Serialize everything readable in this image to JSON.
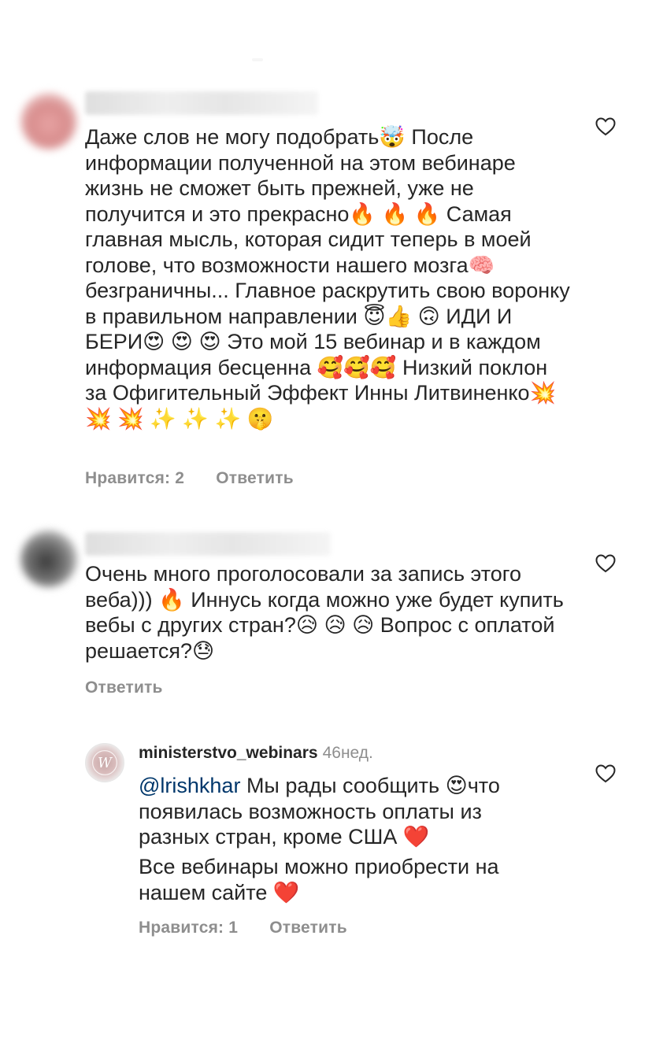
{
  "comments": [
    {
      "text": "Даже слов не могу подобрать🤯 После информации полученной на этом вебинаре жизнь не сможет быть прежней, уже не получится и это прекрасно🔥 🔥 🔥 Самая главная мысль, которая сидит теперь в моей голове, что возможности нашего мозга🧠 безграничны... Главное раскрутить свою воронку в правильном направлении 😇👍 🙃 ИДИ И БЕРИ😍 😍 😍 Это мой 15 вебинар и в каждом информация бесценна 🥰🥰🥰 Низкий поклон за Офигительный Эффект Инны Литвиненко💥 💥 💥 ✨ ✨ ✨ 🤫",
      "likes_label": "Нравится: 2",
      "reply_label": "Ответить"
    },
    {
      "text": "Очень много проголосовали за запись этого веба))) 🔥 Иннусь когда можно уже будет купить вебы с других стран?😥 😥 😥 Вопрос с оплатой решается?😓",
      "reply_label": "Ответить"
    }
  ],
  "reply": {
    "username": "ministerstvo_webinars",
    "time": "46нед.",
    "mention": "@lrishkhar",
    "text_after_mention": " Мы рады сообщить 😍что появилась возможность оплаты из разных стран, кроме США ❤️",
    "text_line2": "Все вебинары можно приобрести на нашем сайте ❤️",
    "likes_label": "Нравится: 1",
    "reply_label": "Ответить"
  },
  "icons": {
    "heart": "heart-outline-icon",
    "avatar_logo": "w-monogram-logo"
  },
  "colors": {
    "text": "#262626",
    "secondary": "#8e8e8e",
    "mention": "#00376b"
  }
}
